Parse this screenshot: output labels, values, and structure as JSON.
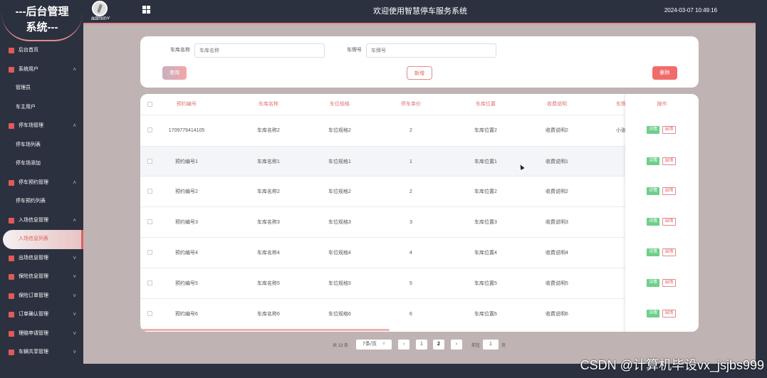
{
  "logo": {
    "line1": "---后台管理",
    "line2": "系统---"
  },
  "header": {
    "username": "admin",
    "username_suffix": "˅",
    "title": "欢迎使用智慧停车服务系统",
    "datetime": "2024-03-07 10:49:16"
  },
  "sidebar": {
    "items": [
      {
        "label": "后台首页",
        "type": "item",
        "chevron": ""
      },
      {
        "label": "系统用户",
        "type": "item",
        "chevron": "˄"
      },
      {
        "label": "管理员",
        "type": "sub",
        "chevron": ""
      },
      {
        "label": "车主用户",
        "type": "sub",
        "chevron": ""
      },
      {
        "label": "停车场管理",
        "type": "item",
        "chevron": "˄"
      },
      {
        "label": "停车场列表",
        "type": "sub",
        "chevron": ""
      },
      {
        "label": "停车场添加",
        "type": "sub",
        "chevron": ""
      },
      {
        "label": "停车预约管理",
        "type": "item",
        "chevron": "˄"
      },
      {
        "label": "停车预约列表",
        "type": "sub",
        "chevron": ""
      },
      {
        "label": "入场信息管理",
        "type": "item",
        "chevron": "˄"
      },
      {
        "label": "入场信息列表",
        "type": "active",
        "chevron": ""
      },
      {
        "label": "出场信息管理",
        "type": "item",
        "chevron": "˅"
      },
      {
        "label": "保险信息管理",
        "type": "item",
        "chevron": "˅"
      },
      {
        "label": "保险订单管理",
        "type": "item",
        "chevron": "˅"
      },
      {
        "label": "订单确认管理",
        "type": "item",
        "chevron": "˅"
      },
      {
        "label": "理赔申请管理",
        "type": "item",
        "chevron": "˅"
      },
      {
        "label": "车辆共享管理",
        "type": "item",
        "chevron": "˅"
      }
    ]
  },
  "search": {
    "garage_label": "车库名称",
    "garage_placeholder": "车库名称",
    "plate_label": "车牌号",
    "plate_placeholder": "车牌号",
    "query_label": "查询",
    "add_label": "新增",
    "delete_label": "删除"
  },
  "table": {
    "headers": [
      "预约编号",
      "车库名称",
      "车位规格",
      "停车单价",
      "车库位置",
      "收费说明",
      "车牌"
    ],
    "op_header": "操作",
    "detail_label": "详情",
    "out_label": "出场",
    "rows": [
      [
        "1709779414105",
        "车库名称2",
        "车位规格2",
        "2",
        "车库位置2",
        "收费说明2",
        "小张"
      ],
      [
        "预约编号1",
        "车库名称1",
        "车位规格1",
        "1",
        "车库位置1",
        "收费说明1",
        ""
      ],
      [
        "预约编号2",
        "车库名称2",
        "车位规格2",
        "2",
        "车库位置2",
        "收费说明2",
        ""
      ],
      [
        "预约编号3",
        "车库名称3",
        "车位规格3",
        "3",
        "车库位置3",
        "收费说明3",
        ""
      ],
      [
        "预约编号4",
        "车库名称4",
        "车位规格4",
        "4",
        "车库位置4",
        "收费说明4",
        ""
      ],
      [
        "预约编号5",
        "车库名称5",
        "车位规格5",
        "5",
        "车库位置5",
        "收费说明5",
        ""
      ],
      [
        "预约编号6",
        "车库名称6",
        "车位规格6",
        "6",
        "车库位置6",
        "收费说明6",
        ""
      ]
    ]
  },
  "pagination": {
    "total": "共 13 条",
    "page_size": "7条/页",
    "page_size_arrow": "˅",
    "prev": "‹",
    "pages": [
      "1",
      "2"
    ],
    "current": "2",
    "next": "›",
    "goto_prefix": "前往",
    "goto_value": "1",
    "goto_suffix": "页"
  },
  "watermark": "CSDN @计算机毕设vx_jsjbs999",
  "colors": {
    "accent": "#e06060",
    "sidebar_bg": "#2c3140",
    "content_bg": "#c0b3b4"
  }
}
